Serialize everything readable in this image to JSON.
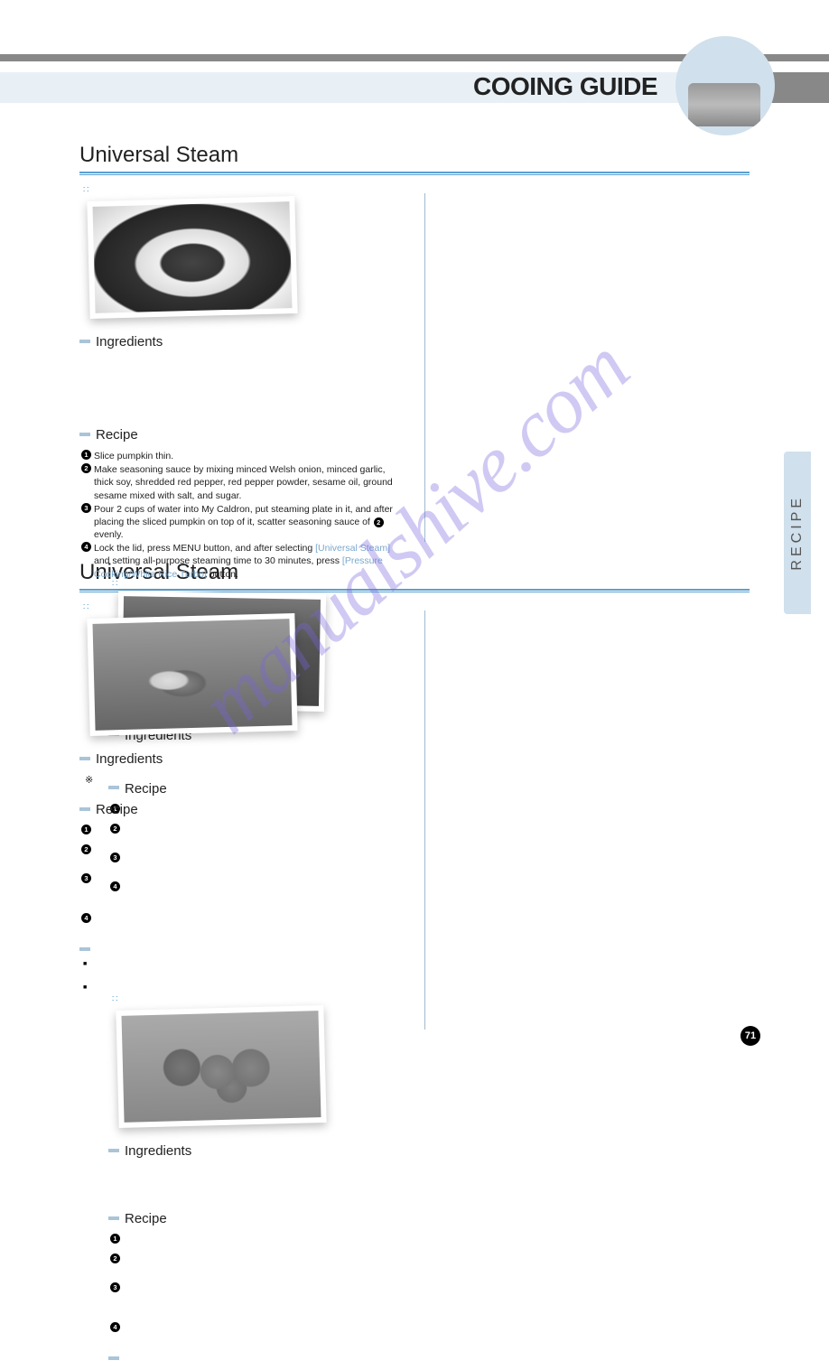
{
  "page_title": "COOING GUIDE",
  "side_tab": "RECIPE",
  "page_number": "71",
  "watermark": "manualshive.com",
  "section1": {
    "heading": "Universal Steam",
    "left": {
      "ingredients_label": "Ingredients",
      "recipe_label": "Recipe",
      "steps": {
        "s1": "Slice pumpkin thin.",
        "s2": "Make seasoning sauce by mixing minced Welsh onion, minced garlic, thick soy, shredded red pepper, red pepper powder, sesame oil, ground sesame mixed with salt, and sugar.",
        "s3_a": "Pour 2 cups of water into My Caldron, put steaming plate in it, and after placing the sliced pumpkin on top of it, scatter seasoning sauce of ",
        "s3_b": " evenly.",
        "s4_a": "Lock the lid, press MENU button, and after selecting ",
        "s4_hl1": "[Universal Steam]",
        "s4_b": " and setting all-purpose steaming time to 30 minutes, press ",
        "s4_hl2": "[Pressure Cooking/White Rice Turbo]",
        "s4_c": " button."
      }
    },
    "right": {
      "ingredients_label": "Ingredients",
      "recipe_label": "Recipe"
    }
  },
  "section2": {
    "heading": "Universal Steam",
    "left": {
      "ingredients_label": "Ingredients",
      "recipe_label": "Recipe",
      "note_mark": "※"
    },
    "right": {
      "ingredients_label": "Ingredients",
      "recipe_label": "Recipe"
    }
  }
}
